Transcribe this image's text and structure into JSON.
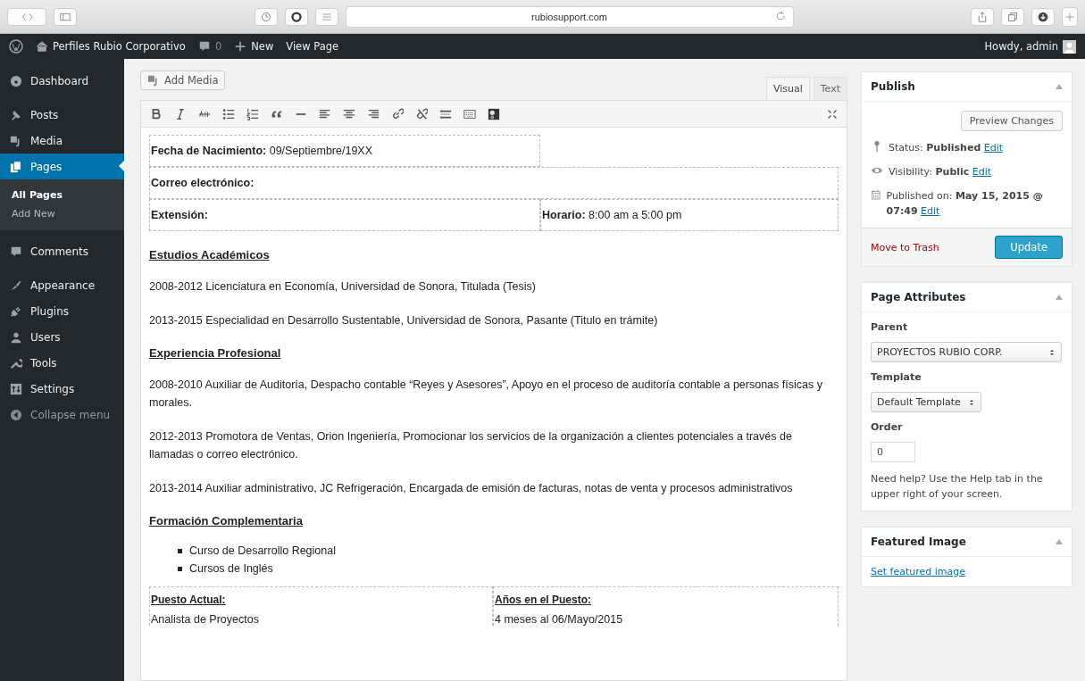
{
  "browser": {
    "url": "rubiosupport.com"
  },
  "admin_bar": {
    "site_title": "Perfiles Rubio Corporativo",
    "comments_count": "0",
    "new_label": "New",
    "view_page": "View Page",
    "greeting": "Howdy, admin"
  },
  "sidebar": {
    "items": [
      {
        "label": "Dashboard",
        "selected": false
      },
      {
        "label": "Posts",
        "selected": false
      },
      {
        "label": "Media",
        "selected": false
      },
      {
        "label": "Pages",
        "selected": true,
        "children": [
          {
            "label": "All Pages",
            "selected": true
          },
          {
            "label": "Add New",
            "selected": false
          }
        ]
      },
      {
        "label": "Comments",
        "selected": false
      },
      {
        "label": "Appearance",
        "selected": false
      },
      {
        "label": "Plugins",
        "selected": false
      },
      {
        "label": "Users",
        "selected": false
      },
      {
        "label": "Tools",
        "selected": false
      },
      {
        "label": "Settings",
        "selected": false
      }
    ],
    "collapse": "Collapse menu"
  },
  "editor": {
    "add_media": "Add Media",
    "tabs": [
      {
        "label": "Visual",
        "selected": true
      },
      {
        "label": "Text",
        "selected": false
      }
    ],
    "content": [
      {
        "kind": "table",
        "rows": [
          {
            "kind": "single",
            "cells": [
              "**Fecha de Nacimiento:** 09/Septiembre/19XX"
            ]
          },
          {
            "kind": "full",
            "cells": [
              "**Correo electrónico:**"
            ]
          },
          {
            "kind": "split",
            "cells": [
              "**Extensión:**",
              "**Horario:** 8:00 am a 5:00 pm"
            ]
          }
        ]
      },
      {
        "kind": "heading",
        "text": "Estudios Académicos"
      },
      {
        "kind": "paragraph",
        "text": "2008-2012 Licenciatura en Economía, Universidad de Sonora, Titulada (Tesis)"
      },
      {
        "kind": "paragraph",
        "text": "2013-2015 Especialidad en Desarrollo Sustentable, Universidad de Sonora, Pasante (Titulo en trámite)"
      },
      {
        "kind": "heading",
        "text": "Experiencia Profesional"
      },
      {
        "kind": "paragraph",
        "text": "2008-2010 Auxiliar de Auditoría, Despacho contable “Reyes y Asesores”, Apoyo en el proceso de auditoría contable a personas físicas y morales."
      },
      {
        "kind": "paragraph",
        "text": "2012-2013 Promotora de Ventas, Orion Ingeniería, Promocionar los servicios de la organización a clientes potenciales a través de llamadas o correo electrónico."
      },
      {
        "kind": "paragraph",
        "text": "2013-2014 Auxiliar administrativo, JC Refrigeración, Encargada de emisión de facturas, notas de venta y procesos administrativos"
      },
      {
        "kind": "heading",
        "text": "Formación Complementaria"
      },
      {
        "kind": "list",
        "items": [
          "Curso de Desarrollo Regional",
          "Cursos de Inglés"
        ]
      },
      {
        "kind": "columns",
        "cells": [
          {
            "heading": "Puesto Actual:",
            "value": "Analista de Proyectos"
          },
          {
            "heading": "Años en el Puesto:",
            "value": "4 meses al 06/Mayo/2015"
          }
        ]
      }
    ]
  },
  "publish": {
    "title": "Publish",
    "preview": "Preview Changes",
    "rows": [
      {
        "label": "Status:",
        "value": "Published",
        "link": "Edit"
      },
      {
        "label": "Visibility:",
        "value": "Public",
        "link": "Edit"
      },
      {
        "label": "Published on:",
        "value": "May 15, 2015 @ 07:49",
        "link": "Edit"
      }
    ],
    "trash": "Move to Trash",
    "update": "Update"
  },
  "page_attributes": {
    "title": "Page Attributes",
    "parent_label": "Parent",
    "parent_value": "PROYECTOS RUBIO CORP.",
    "template_label": "Template",
    "template_value": "Default Template",
    "order_label": "Order",
    "order_value": "0",
    "help": "Need help? Use the Help tab in the upper right of your screen."
  },
  "featured_image": {
    "title": "Featured Image",
    "link": "Set featured image"
  }
}
